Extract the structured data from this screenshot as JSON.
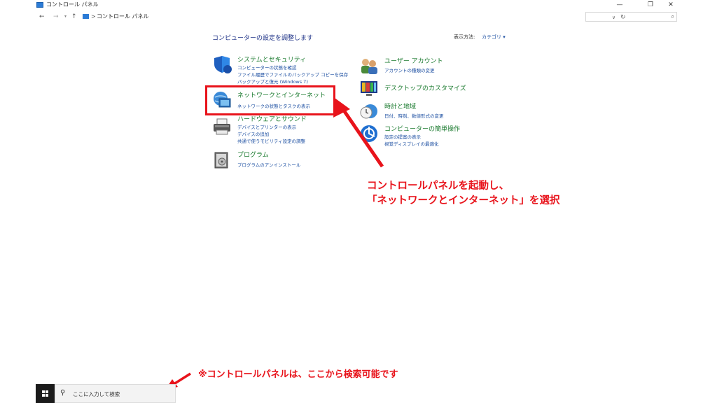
{
  "window": {
    "title": "コントロール パネル",
    "controls": {
      "minimize": "—",
      "maximize": "❐",
      "close": "✕"
    }
  },
  "address_bar": {
    "back": "←",
    "forward": "→",
    "history": "▾",
    "up": "↑",
    "separator": ">",
    "path": "コントロール パネル",
    "dropdown": "∨",
    "refresh": "↻",
    "search_placeholder": "",
    "search_icon": "⌕"
  },
  "content": {
    "heading": "コンピューターの設定を調整します",
    "view_by_label": "表示方法:",
    "view_by_value": "カテゴリ ▾",
    "categories": [
      {
        "title": "システムとセキュリティ",
        "icon": "shield-icon",
        "links": [
          "コンピューターの状態を確認",
          "ファイル履歴でファイルのバックアップ コピーを保存",
          "バックアップと復元 (Windows 7)"
        ]
      },
      {
        "title": "ネットワークとインターネット",
        "icon": "network-globe-icon",
        "links": [
          "ネットワークの状態とタスクの表示"
        ]
      },
      {
        "title": "ハードウェアとサウンド",
        "icon": "printer-icon",
        "links": [
          "デバイスとプリンターの表示",
          "デバイスの追加",
          "共通で使うモビリティ設定の調整"
        ]
      },
      {
        "title": "プログラム",
        "icon": "programs-icon",
        "links": [
          "プログラムのアンインストール"
        ]
      },
      {
        "title": "ユーザー アカウント",
        "icon": "users-icon",
        "links": [
          "アカウントの種類の変更"
        ]
      },
      {
        "title": "デスクトップのカスタマイズ",
        "icon": "desktop-icon",
        "links": []
      },
      {
        "title": "時計と地域",
        "icon": "clock-globe-icon",
        "links": [
          "日付、時刻、数値形式の変更"
        ]
      },
      {
        "title": "コンピューターの簡単操作",
        "icon": "ease-of-access-icon",
        "links": [
          "設定の提案の表示",
          "視覚ディスプレイの最適化"
        ]
      }
    ]
  },
  "annotations": {
    "main_line1": "コントロールパネルを起動し、",
    "main_line2": "「ネットワークとインターネット」を選択",
    "note": "※コントロールパネルは、ここから検索可能です"
  },
  "taskbar": {
    "search_placeholder": "ここに入力して検索"
  },
  "colors": {
    "annotation_red": "#e8131b",
    "category_green": "#1a7a2e",
    "link_blue": "#1e50a2",
    "heading_blue": "#1e3287"
  }
}
